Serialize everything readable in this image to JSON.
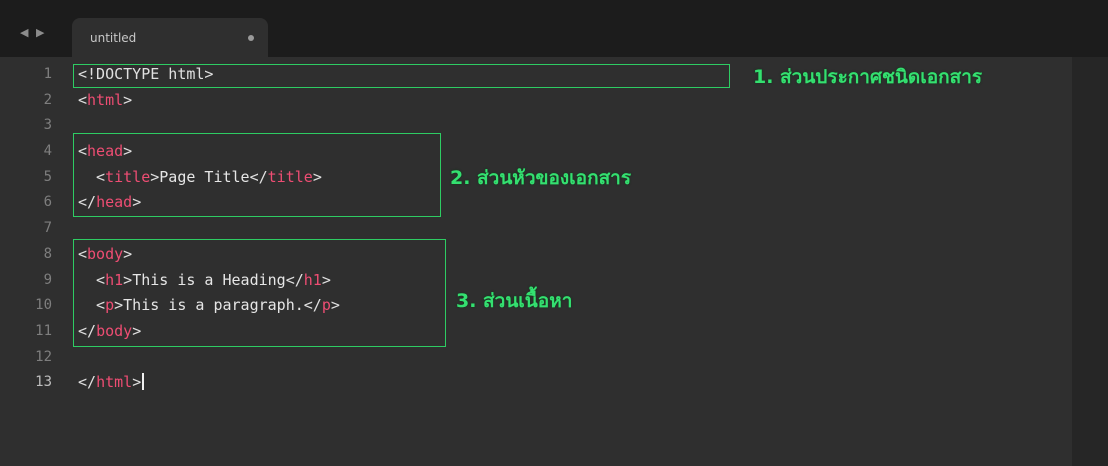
{
  "tab": {
    "title": "untitled"
  },
  "nav_arrows": "◀ ▶",
  "editor": {
    "active_line": 13,
    "lines": [
      {
        "no": "1",
        "parts": [
          [
            "punct",
            "<!DOCTYPE html>"
          ]
        ]
      },
      {
        "no": "2",
        "parts": [
          [
            "punct",
            "<"
          ],
          [
            "tag",
            "html"
          ],
          [
            "punct",
            ">"
          ]
        ]
      },
      {
        "no": "3",
        "parts": []
      },
      {
        "no": "4",
        "parts": [
          [
            "punct",
            "<"
          ],
          [
            "tag",
            "head"
          ],
          [
            "punct",
            ">"
          ]
        ]
      },
      {
        "no": "5",
        "parts": [
          [
            "punct",
            "  <"
          ],
          [
            "tag",
            "title"
          ],
          [
            "punct",
            ">"
          ],
          [
            "txt",
            "Page Title"
          ],
          [
            "punct",
            "</"
          ],
          [
            "tag",
            "title"
          ],
          [
            "punct",
            ">"
          ]
        ]
      },
      {
        "no": "6",
        "parts": [
          [
            "punct",
            "</"
          ],
          [
            "tag",
            "head"
          ],
          [
            "punct",
            ">"
          ]
        ]
      },
      {
        "no": "7",
        "parts": []
      },
      {
        "no": "8",
        "parts": [
          [
            "punct",
            "<"
          ],
          [
            "tag",
            "body"
          ],
          [
            "punct",
            ">"
          ]
        ]
      },
      {
        "no": "9",
        "parts": [
          [
            "punct",
            "  <"
          ],
          [
            "tag",
            "h1"
          ],
          [
            "punct",
            ">"
          ],
          [
            "txt",
            "This is a Heading"
          ],
          [
            "punct",
            "</"
          ],
          [
            "tag",
            "h1"
          ],
          [
            "punct",
            ">"
          ]
        ]
      },
      {
        "no": "10",
        "parts": [
          [
            "punct",
            "  <"
          ],
          [
            "tag",
            "p"
          ],
          [
            "punct",
            ">"
          ],
          [
            "txt",
            "This is a paragraph."
          ],
          [
            "punct",
            "</"
          ],
          [
            "tag",
            "p"
          ],
          [
            "punct",
            ">"
          ]
        ]
      },
      {
        "no": "11",
        "parts": [
          [
            "punct",
            "</"
          ],
          [
            "tag",
            "body"
          ],
          [
            "punct",
            ">"
          ]
        ]
      },
      {
        "no": "12",
        "parts": []
      },
      {
        "no": "13",
        "parts": [
          [
            "punct",
            "</"
          ],
          [
            "tag",
            "html"
          ],
          [
            "punct",
            ">"
          ]
        ]
      }
    ]
  },
  "annotations": {
    "doctype": "1. ส่วนประกาศชนิดเอกสาร",
    "head": "2. ส่วนหัวของเอกสาร",
    "body": "3. ส่วนเนื้อหา"
  },
  "colors": {
    "background": "#2f2f2f",
    "tag": "#ee4d73",
    "annotation": "#34e070"
  }
}
